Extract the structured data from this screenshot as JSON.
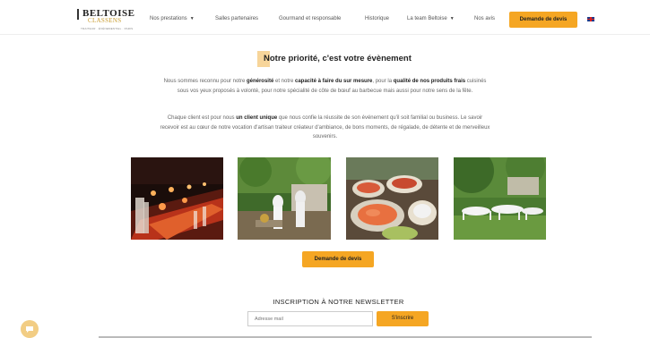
{
  "header": {
    "logo": {
      "main": "BELTOISE",
      "sub": "CLASSENS",
      "tagline": "TRAITEUR · ÉVÉNEMENTIEL · PARIS"
    },
    "nav": [
      {
        "label": "Nos prestations",
        "has_dropdown": true
      },
      {
        "label": "Salles partenaires",
        "has_dropdown": false
      },
      {
        "label": "Gourmand et responsable",
        "has_dropdown": false
      },
      {
        "label": "Historique",
        "has_dropdown": false
      },
      {
        "label": "La team Beltoise",
        "has_dropdown": true
      },
      {
        "label": "Nos avis",
        "has_dropdown": false
      }
    ],
    "cta": "Demande de devis",
    "language_flag": "uk-flag-icon"
  },
  "main": {
    "heading": "Notre priorité, c'est votre évènement",
    "para1": {
      "t1": "Nous sommes reconnu pour notre ",
      "b1": "générosité",
      "t2": " et notre ",
      "b2": "capacité à faire du sur mesure",
      "t3": ", pour la ",
      "b3": "qualité de nos produits frais",
      "t4": " cuisinés sous vos yeux proposés à volonté, pour notre spécialité de côte de bœuf au barbecue mais aussi pour notre sens de la fête."
    },
    "para2": {
      "t1": "Chaque client est pour nous ",
      "b1": "un client unique",
      "t2": " que nous confie la réussite de son événement qu'il soit familial ou business. Le savoir recevoir est au cœur de notre vocation d'artisan traiteur créateur d'ambiance, de bons moments, de régalade, de détente et de merveilleux souvenirs."
    },
    "gallery": [
      {
        "name": "candlelit-banquet-photo"
      },
      {
        "name": "garden-reception-photo"
      },
      {
        "name": "buffet-food-photo"
      },
      {
        "name": "outdoor-tables-photo"
      }
    ],
    "cta": "Demande de devis"
  },
  "newsletter": {
    "title": "INSCRIPTION À NOTRE NEWSLETTER",
    "placeholder": "Adresse mail",
    "button": "S'inscrire"
  },
  "colors": {
    "accent": "#f5a623",
    "accent_light": "#f7d59a",
    "text": "#666666"
  }
}
